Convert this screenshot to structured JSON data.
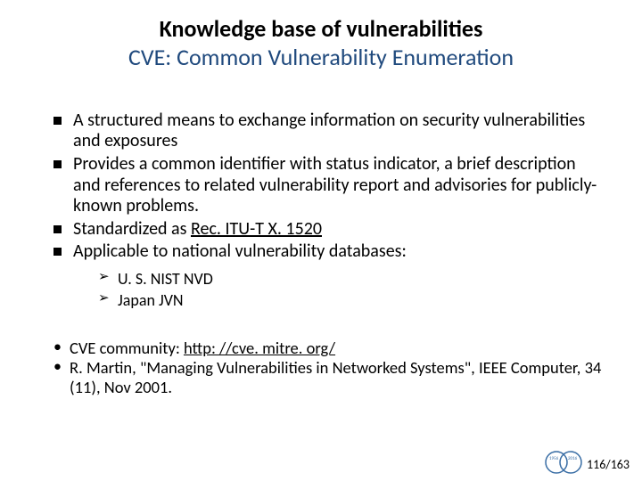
{
  "title": "Knowledge base of vulnerabilities",
  "subtitle": "CVE: Common Vulnerability Enumeration",
  "bullets": [
    "A structured means to exchange information on security vulnerabilities and exposures",
    "Provides a common identifier with status indicator, a brief description and references to related vulnerability report and advisories for publicly-known problems.",
    "Standardized as ",
    "Applicable to national vulnerability databases:"
  ],
  "std_link": "Rec. ITU-T X. 1520",
  "sub_bullets": [
    "U. S. NIST NVD",
    "Japan JVN"
  ],
  "refs_prefix": [
    "CVE community: ",
    "R. Martin, \"Managing Vulnerabilities in Networked Systems\", IEEE Computer, 34 (11), Nov 2001."
  ],
  "refs_link": "http: //cve. mitre. org/",
  "page_number": "116/163"
}
